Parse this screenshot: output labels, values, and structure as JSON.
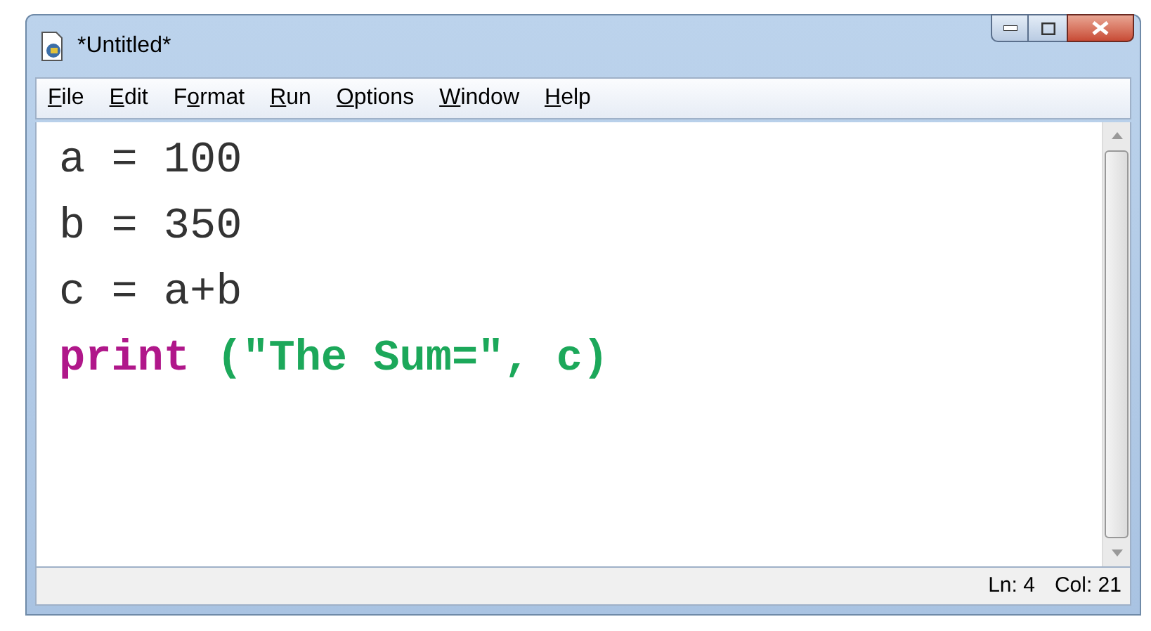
{
  "window": {
    "title": "*Untitled*"
  },
  "menu": [
    {
      "key": "F",
      "post": "ile"
    },
    {
      "key": "E",
      "post": "dit"
    },
    {
      "pre": "F",
      "key": "o",
      "post": "rmat"
    },
    {
      "key": "R",
      "post": "un"
    },
    {
      "key": "O",
      "post": "ptions"
    },
    {
      "key": "W",
      "post": "indow"
    },
    {
      "key": "H",
      "post": "elp"
    }
  ],
  "editor": {
    "lines": [
      [
        {
          "kind": "plain",
          "text": "a = 100"
        }
      ],
      [
        {
          "kind": "plain",
          "text": "b = 350"
        }
      ],
      [
        {
          "kind": "plain",
          "text": "c = a+b"
        }
      ],
      [
        {
          "kind": "keyword",
          "text": "print"
        },
        {
          "kind": "string",
          "text": "(\"The Sum=\", c)"
        }
      ]
    ]
  },
  "status_bar": {
    "line": "Ln: 4",
    "column": "Col: 21"
  }
}
